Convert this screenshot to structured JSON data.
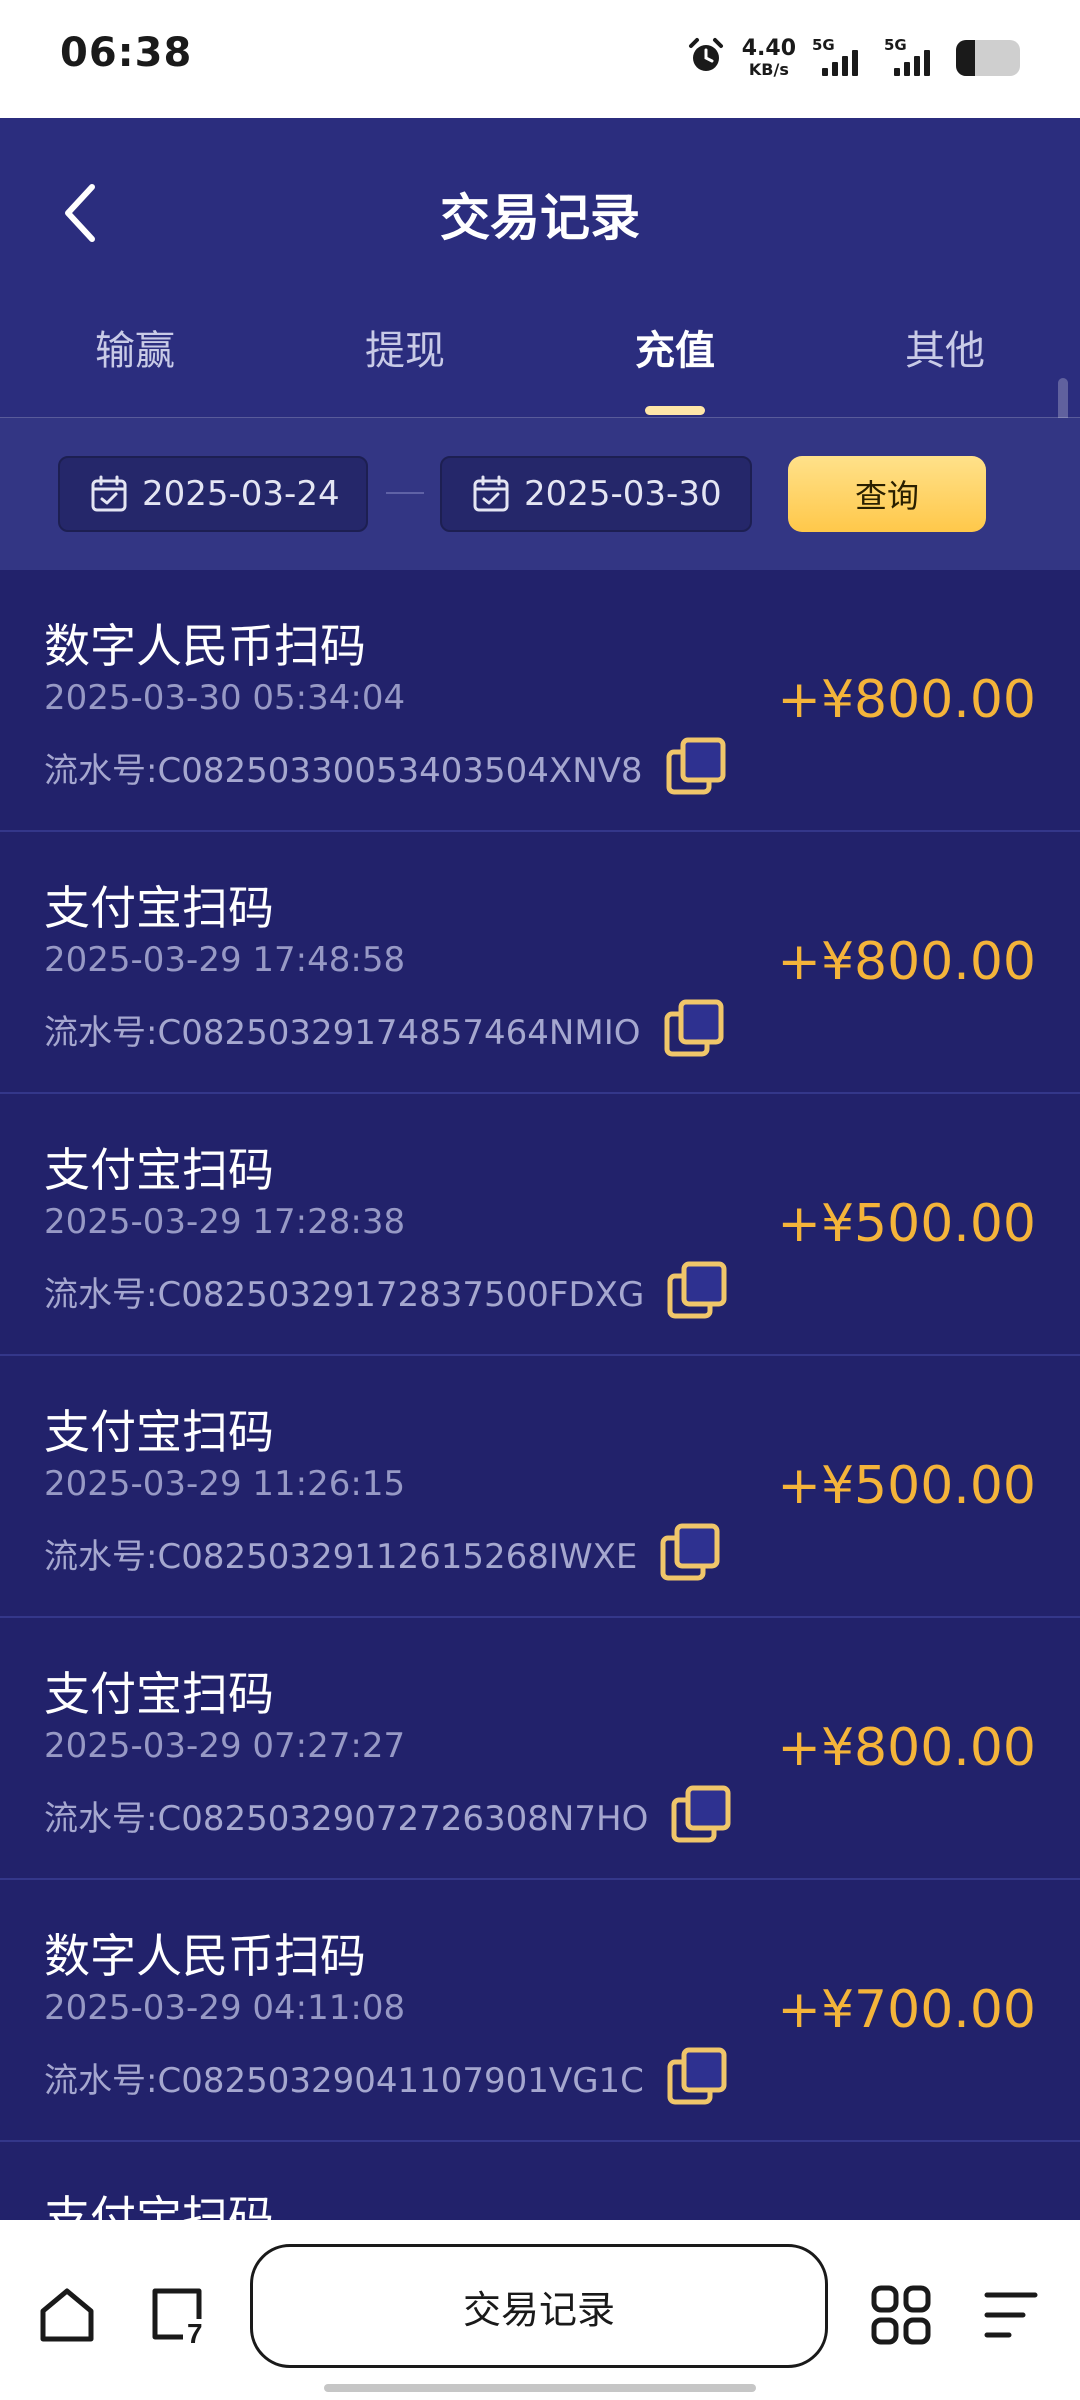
{
  "status_bar": {
    "time": "06:38",
    "net_speed_value": "4.40",
    "net_speed_unit": "KB/s",
    "sim1_label": "5G",
    "sim2_label": "5G",
    "battery_level": 0.3
  },
  "header": {
    "title": "交易记录",
    "tabs": [
      "输赢",
      "提现",
      "充值",
      "其他"
    ],
    "active_tab": "充值"
  },
  "filter": {
    "start_date": "2025-03-24",
    "end_date": "2025-03-30",
    "query_label": "查询"
  },
  "records": [
    {
      "title": "数字人民币扫码",
      "time": "2025-03-30 05:34:04",
      "serial": "流水号:C08250330053403504XNV8",
      "amount": "+¥800.00"
    },
    {
      "title": "支付宝扫码",
      "time": "2025-03-29 17:48:58",
      "serial": "流水号:C08250329174857464NMIO",
      "amount": "+¥800.00"
    },
    {
      "title": "支付宝扫码",
      "time": "2025-03-29 17:28:38",
      "serial": "流水号:C08250329172837500FDXG",
      "amount": "+¥500.00"
    },
    {
      "title": "支付宝扫码",
      "time": "2025-03-29 11:26:15",
      "serial": "流水号:C08250329112615268IWXE",
      "amount": "+¥500.00"
    },
    {
      "title": "支付宝扫码",
      "time": "2025-03-29 07:27:27",
      "serial": "流水号:C08250329072726308N7HO",
      "amount": "+¥800.00"
    },
    {
      "title": "数字人民币扫码",
      "time": "2025-03-29 04:11:08",
      "serial": "流水号:C08250329041107901VG1C",
      "amount": "+¥700.00"
    },
    {
      "title": "支付宝扫码",
      "time": "",
      "serial": "",
      "amount": ""
    }
  ],
  "bottom_nav": {
    "center_label": "交易记录",
    "tabs_badge": "7"
  },
  "colors": {
    "header_bg": "#2b2d7e",
    "list_bg": "#22226b",
    "amount": "#f4b43a",
    "accent_button": "#ffc84a"
  }
}
